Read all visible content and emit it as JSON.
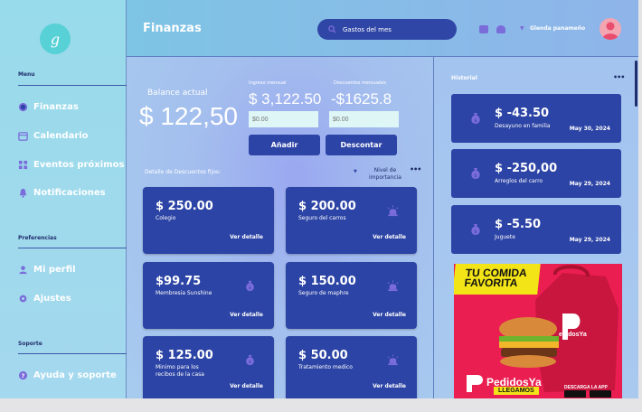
{
  "app": {
    "logo_letter": "g",
    "title": "Finanzas"
  },
  "sidebar": {
    "sections": {
      "menu": "Menu",
      "preferences": "Preferencias",
      "support": "Soporte"
    },
    "items": [
      {
        "label": "Finanzas",
        "icon": "dollar-circle-icon"
      },
      {
        "label": "Calendario",
        "icon": "calendar-icon"
      },
      {
        "label": "Eventos próximos",
        "icon": "grid-icon"
      },
      {
        "label": "Notificaciones",
        "icon": "bell-icon"
      },
      {
        "label": "Mi perfil",
        "icon": "user-icon"
      },
      {
        "label": "Ajustes",
        "icon": "gear-icon"
      },
      {
        "label": "Ayuda y soporte",
        "icon": "help-icon"
      }
    ]
  },
  "header": {
    "search_value": "Gastos del mes",
    "user_name": "Glenda panameño"
  },
  "balance": {
    "label": "Balance actual",
    "value": "$ 122,50"
  },
  "income": {
    "label": "Ingreso mensual",
    "value": "$ 3,122.50",
    "input_placeholder": "$0.00",
    "button": "Añadir"
  },
  "discounts": {
    "label": "Descuentos mensuales",
    "value": "-$1625.8",
    "input_placeholder": "$0.00",
    "button": "Descontar"
  },
  "fixed": {
    "label": "Detalle de Descuentos fijos:",
    "importance_label": "Nivel de importancia",
    "link_label": "Ver detalle",
    "cards": [
      {
        "amount": "$ 250.00",
        "name": "Colegio",
        "icon": ""
      },
      {
        "amount": "$ 200.00",
        "name": "Seguro del carros",
        "icon": "siren-icon"
      },
      {
        "amount": "$99.75",
        "name": "Membresia Sunshine",
        "icon": "money-bag-icon"
      },
      {
        "amount": "$ 150.00",
        "name": "Seguro de maphre",
        "icon": "siren-icon"
      },
      {
        "amount": "$ 125.00",
        "name": "Minimo para los recibos de la casa",
        "icon": "money-bag-icon"
      },
      {
        "amount": "$ 50.00",
        "name": "Tratamiento medico",
        "icon": "siren-icon"
      }
    ]
  },
  "history": {
    "title": "Historial",
    "items": [
      {
        "amount": "$ -43.50",
        "desc": "Desayuno en familia",
        "date": "May 30, 2024"
      },
      {
        "amount": "$ -250,00",
        "desc": "Arreglos del carro",
        "date": "May 29, 2024"
      },
      {
        "amount": "$ -5.50",
        "desc": "Juguete",
        "date": "May 29, 2024"
      }
    ]
  },
  "ad": {
    "headline_1": "TU COMIDA",
    "headline_2": "FAVORITA",
    "brand": "PedidosYa",
    "tagline": "LLEGAMOS",
    "download": "DESCARGA LA APP"
  },
  "colors": {
    "accent": "#2c44a5",
    "icon_purple": "#7a6cd9",
    "ad_red": "#eb1e52",
    "ad_yellow": "#f3e417"
  }
}
